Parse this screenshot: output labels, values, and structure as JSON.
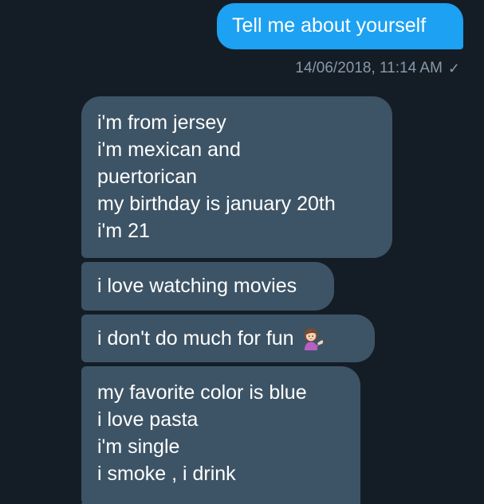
{
  "conversation": {
    "sent_message": {
      "text": "Tell me about yourself",
      "timestamp": "14/06/2018, 11:14 AM",
      "status_icon": "checkmark-icon"
    },
    "received_messages": [
      {
        "lines": [
          "i'm from jersey",
          "i'm mexican and",
          "puertorican",
          "my birthday is january 20th",
          "i'm 21"
        ]
      },
      {
        "lines": [
          "i love watching movies"
        ]
      },
      {
        "lines": [
          "i don't do much for fun"
        ],
        "emoji": "woman-tipping-hand-emoji"
      },
      {
        "lines": [
          "my favorite color is blue",
          "i love pasta",
          "i'm single",
          "i smoke , i drink"
        ]
      }
    ]
  },
  "colors": {
    "background": "#141d26",
    "sent_bubble": "#1da1f2",
    "received_bubble": "#3d5466",
    "meta_text": "#8899a6",
    "message_text": "#ffffff"
  }
}
